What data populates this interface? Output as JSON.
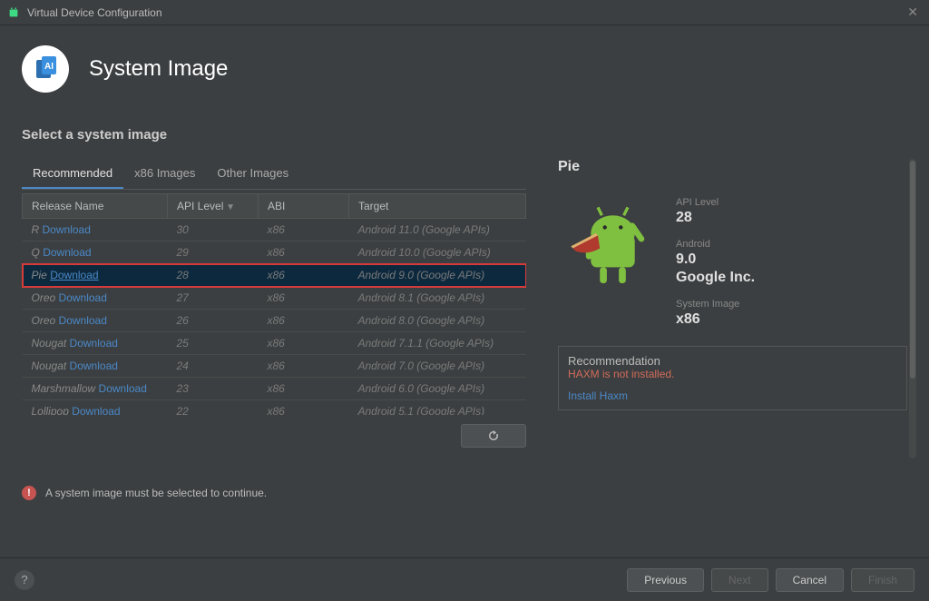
{
  "window": {
    "title": "Virtual Device Configuration"
  },
  "header": {
    "title": "System Image"
  },
  "section_title": "Select a system image",
  "tabs": [
    {
      "label": "Recommended"
    },
    {
      "label": "x86 Images"
    },
    {
      "label": "Other Images"
    }
  ],
  "table": {
    "cols": {
      "release": "Release Name",
      "api": "API Level",
      "abi": "ABI",
      "target": "Target"
    },
    "rows": [
      {
        "release": "R",
        "dl": "Download",
        "api": "30",
        "abi": "x86",
        "target": "Android 11.0 (Google APIs)"
      },
      {
        "release": "Q",
        "dl": "Download",
        "api": "29",
        "abi": "x86",
        "target": "Android 10.0 (Google APIs)"
      },
      {
        "release": "Pie",
        "dl": "Download",
        "api": "28",
        "abi": "x86",
        "target": "Android 9.0 (Google APIs)",
        "selected": true
      },
      {
        "release": "Oreo",
        "dl": "Download",
        "api": "27",
        "abi": "x86",
        "target": "Android 8.1 (Google APIs)"
      },
      {
        "release": "Oreo",
        "dl": "Download",
        "api": "26",
        "abi": "x86",
        "target": "Android 8.0 (Google APIs)"
      },
      {
        "release": "Nougat",
        "dl": "Download",
        "api": "25",
        "abi": "x86",
        "target": "Android 7.1.1 (Google APIs)"
      },
      {
        "release": "Nougat",
        "dl": "Download",
        "api": "24",
        "abi": "x86",
        "target": "Android 7.0 (Google APIs)"
      },
      {
        "release": "Marshmallow",
        "dl": "Download",
        "api": "23",
        "abi": "x86",
        "target": "Android 6.0 (Google APIs)"
      },
      {
        "release": "Lollipop",
        "dl": "Download",
        "api": "22",
        "abi": "x86",
        "target": "Android 5.1 (Google APIs)"
      }
    ]
  },
  "details": {
    "name": "Pie",
    "api_label": "API Level",
    "api_val": "28",
    "android_label": "Android",
    "android_val": "9.0",
    "vendor": "Google Inc.",
    "sysimg_label": "System Image",
    "sysimg_val": "x86"
  },
  "recommendation": {
    "legend": "Recommendation",
    "warn": "HAXM is not installed.",
    "link": "Install Haxm"
  },
  "error_msg": "A system image must be selected to continue.",
  "footer": {
    "previous": "Previous",
    "next": "Next",
    "cancel": "Cancel",
    "finish": "Finish"
  }
}
